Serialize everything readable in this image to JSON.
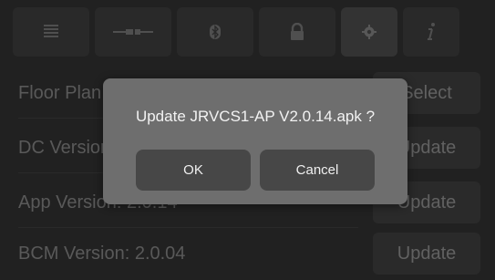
{
  "toolbar": {
    "items": [
      {
        "name": "list-icon"
      },
      {
        "name": "connector-icon"
      },
      {
        "name": "bluetooth-icon"
      },
      {
        "name": "lock-icon"
      },
      {
        "name": "gear-icon",
        "active": true
      },
      {
        "name": "info-icon"
      }
    ]
  },
  "rows": [
    {
      "label": "Floor Plan",
      "action": "Select"
    },
    {
      "label": "DC Version",
      "action": "Update"
    },
    {
      "label": "App Version: 2.0.14",
      "action": "Update"
    },
    {
      "label": "BCM Version: 2.0.04",
      "action": "Update"
    }
  ],
  "dialog": {
    "message": "Update JRVCS1-AP V2.0.14.apk ?",
    "ok_label": "OK",
    "cancel_label": "Cancel"
  },
  "colors": {
    "background": "#2b2b2b",
    "dialog": "#6e6e6e",
    "dialog_button": "#474747"
  }
}
